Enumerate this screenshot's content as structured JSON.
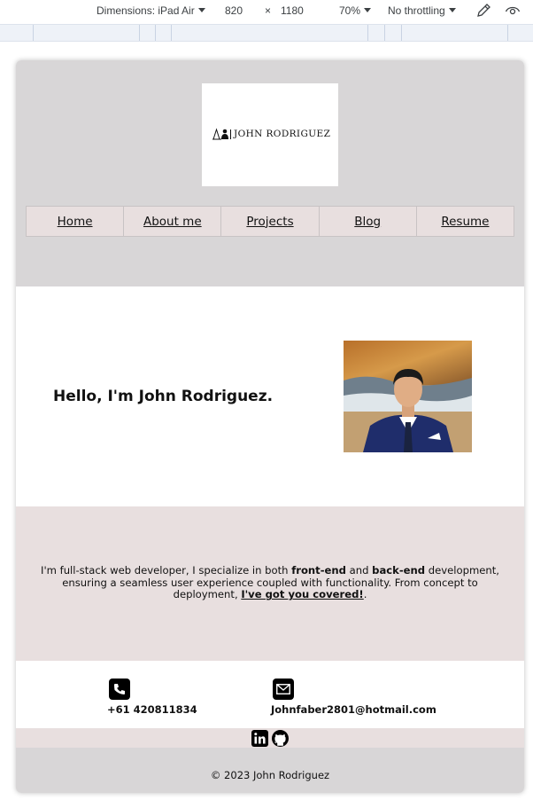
{
  "devtools": {
    "dimensions_label": "Dimensions: iPad Air",
    "width": "820",
    "times": "×",
    "height": "1180",
    "zoom": "70%",
    "throttling": "No throttling",
    "icons": [
      "eyedropper-icon",
      "eye-icon"
    ]
  },
  "site": {
    "logo_text": "JOHN RODRIGUEZ",
    "nav": [
      "Home",
      "About me",
      "Projects",
      "Blog",
      "Resume"
    ],
    "hero_title": "Hello, I'm John Rodriguez.",
    "about": {
      "p1": "I'm full-stack web developer, I specialize in both ",
      "b1": "front-end",
      "p2": " and ",
      "b2": "back-end",
      "p3": " development, ensuring a seamless user experience coupled with functionality. From concept to deployment, ",
      "link": "I've got you covered!",
      "p4": "."
    },
    "contact": {
      "phone": "+61 420811834",
      "email": "Johnfaber2801@hotmail.com",
      "icons": [
        "phone-icon",
        "mail-icon"
      ]
    },
    "social_icons": [
      "linkedin-icon",
      "github-icon"
    ],
    "footer": "© 2023 John Rodriguez"
  }
}
